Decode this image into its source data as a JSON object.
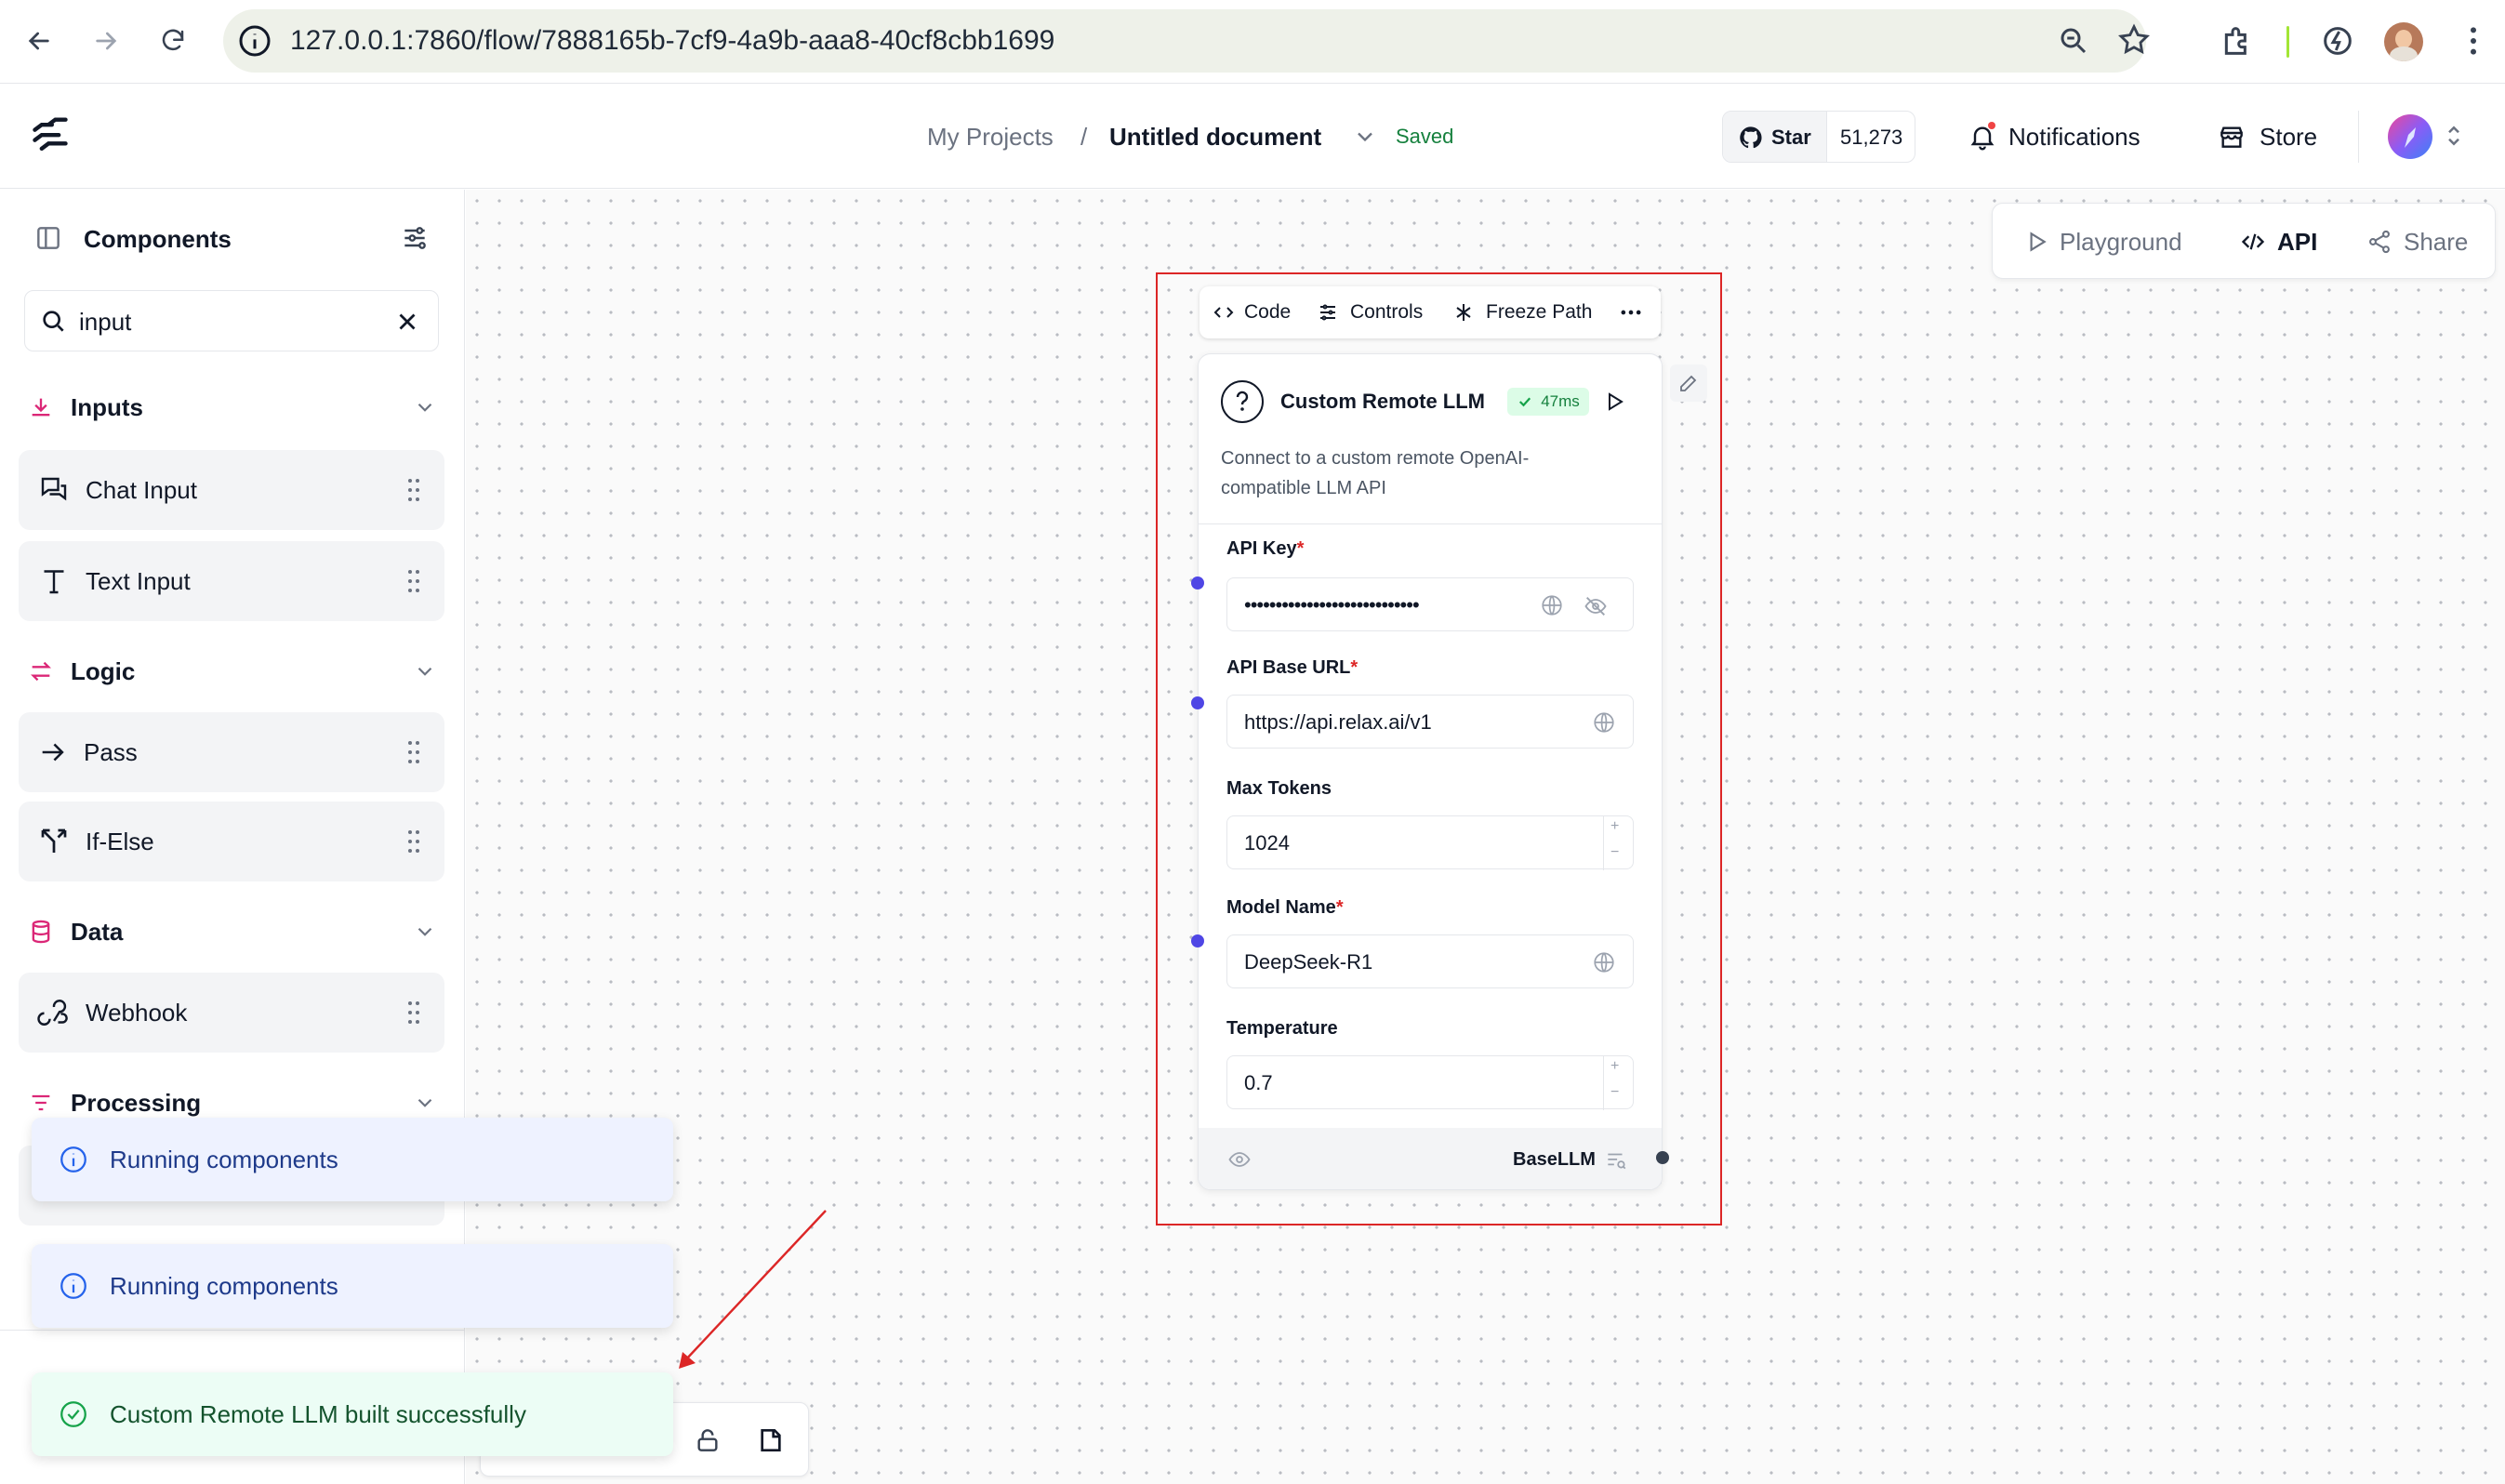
{
  "browser": {
    "url": "127.0.0.1:7860/flow/7888165b-7cf9-4a9b-aaa8-40cf8cbb1699"
  },
  "header": {
    "breadcrumb_projects": "My Projects",
    "breadcrumb_sep": "/",
    "document_title": "Untitled document",
    "save_status": "Saved",
    "github_star_label": "Star",
    "github_star_count": "51,273",
    "notifications_label": "Notifications",
    "store_label": "Store"
  },
  "sidebar": {
    "title": "Components",
    "search": {
      "value": "input"
    },
    "categories": [
      {
        "label": "Inputs",
        "items": [
          "Chat Input",
          "Text Input"
        ]
      },
      {
        "label": "Logic",
        "items": [
          "Pass",
          "If-Else"
        ]
      },
      {
        "label": "Data",
        "items": [
          "Webhook"
        ]
      },
      {
        "label": "Processing",
        "items": []
      }
    ]
  },
  "canvas_toolbar": {
    "playground": "Playground",
    "api": "API",
    "share": "Share"
  },
  "node_toolbar": {
    "code": "Code",
    "controls": "Controls",
    "freeze_path": "Freeze Path"
  },
  "node": {
    "title": "Custom Remote LLM",
    "build_time": "47ms",
    "description_line1": "Connect to a custom remote OpenAI-",
    "description_line2": "compatible LLM API",
    "fields": {
      "api_key": {
        "label": "API Key",
        "required": "*",
        "value": "••••••••••••••••••••••••••••"
      },
      "api_base_url": {
        "label": "API Base URL",
        "required": "*",
        "value": "https://api.relax.ai/v1"
      },
      "max_tokens": {
        "label": "Max Tokens",
        "value": "1024"
      },
      "model_name": {
        "label": "Model Name",
        "required": "*",
        "value": "DeepSeek-R1"
      },
      "temperature": {
        "label": "Temperature",
        "value": "0.7"
      }
    },
    "output_label": "BaseLLM"
  },
  "toasts": [
    {
      "type": "info",
      "text": "Running components"
    },
    {
      "type": "info",
      "text": "Running components"
    },
    {
      "type": "success",
      "text": "Custom Remote LLM built successfully"
    }
  ],
  "colors": {
    "accent": "#4f46e5",
    "highlight": "#dc2626",
    "success": "#16a34a",
    "info_bg": "#eef2ff",
    "success_bg": "#ecfdf5",
    "saved_text": "#15803d"
  }
}
